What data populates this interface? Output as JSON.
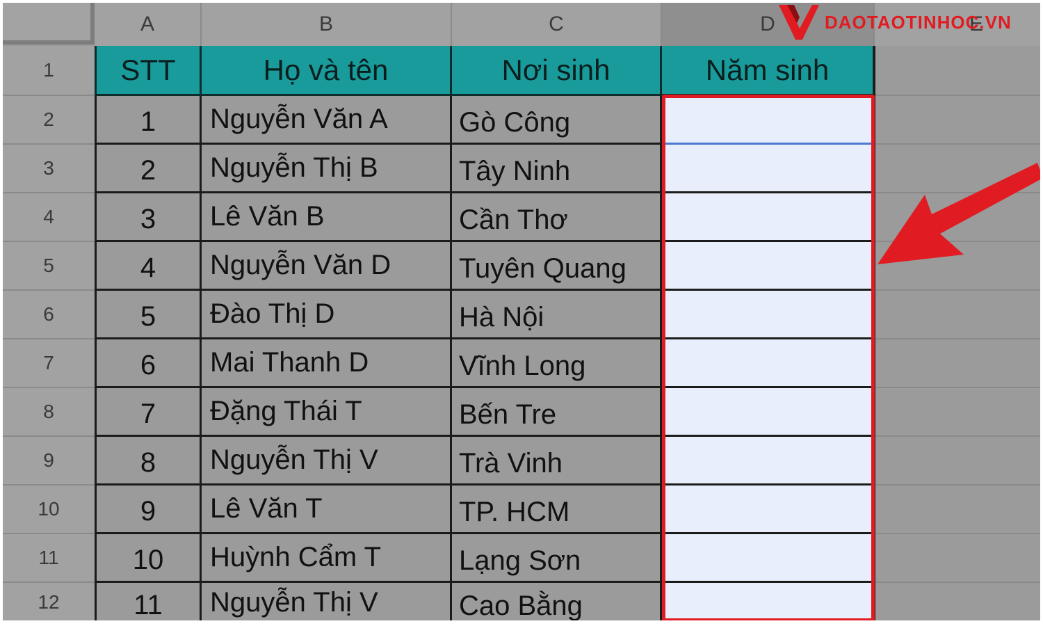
{
  "columns": [
    "A",
    "B",
    "C",
    "D",
    "E"
  ],
  "rows": [
    "1",
    "2",
    "3",
    "4",
    "5",
    "6",
    "7",
    "8",
    "9",
    "10",
    "11",
    "12"
  ],
  "header": {
    "stt": "STT",
    "name": "Họ và tên",
    "birthplace": "Nơi sinh",
    "birthyear": "Năm sinh"
  },
  "records": [
    {
      "stt": "1",
      "name": "Nguyễn Văn A",
      "place": "Gò Công",
      "year": ""
    },
    {
      "stt": "2",
      "name": "Nguyễn Thị B",
      "place": "Tây Ninh",
      "year": ""
    },
    {
      "stt": "3",
      "name": "Lê Văn B",
      "place": "Cần Thơ",
      "year": ""
    },
    {
      "stt": "4",
      "name": "Nguyễn Văn D",
      "place": "Tuyên Quang",
      "year": ""
    },
    {
      "stt": "5",
      "name": "Đào Thị D",
      "place": "Hà Nội",
      "year": ""
    },
    {
      "stt": "6",
      "name": "Mai Thanh D",
      "place": "Vĩnh Long",
      "year": ""
    },
    {
      "stt": "7",
      "name": "Đặng Thái T",
      "place": "Bến Tre",
      "year": ""
    },
    {
      "stt": "8",
      "name": "Nguyễn Thị V",
      "place": "Trà Vinh",
      "year": ""
    },
    {
      "stt": "9",
      "name": "Lê Văn T",
      "place": "TP. HCM",
      "year": ""
    },
    {
      "stt": "10",
      "name": "Huỳnh Cẩm T",
      "place": "Lạng Sơn",
      "year": ""
    },
    {
      "stt": "11",
      "name": "Nguyễn Thị V",
      "place": "Cao Bằng",
      "year": ""
    }
  ],
  "logo": {
    "text": "DAOTAOTINHOC.VN"
  },
  "colors": {
    "header_fill": "#1a9b9b",
    "highlight": "#e11b22",
    "selected_fill": "#e8eefb",
    "sheet_bg": "#9b9b9b"
  }
}
